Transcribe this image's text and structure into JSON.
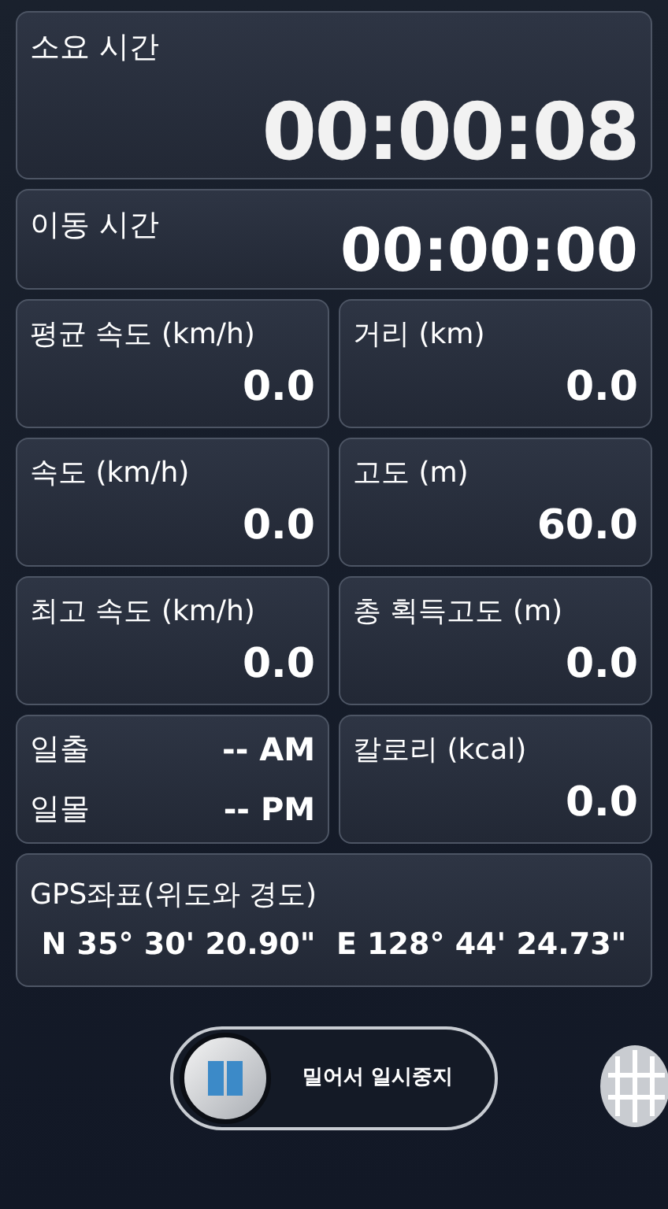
{
  "elapsed": {
    "label": "소요 시간",
    "value": "00:00:08"
  },
  "moving": {
    "label": "이동 시간",
    "value": "00:00:00"
  },
  "stats": [
    {
      "kind": "stat",
      "label": "평균 속도 (km/h)",
      "value": "0.0"
    },
    {
      "kind": "stat",
      "label": "거리 (km)",
      "value": "0.0"
    },
    {
      "kind": "stat",
      "label": "속도 (km/h)",
      "value": "0.0"
    },
    {
      "kind": "stat",
      "label": "고도 (m)",
      "value": "60.0"
    },
    {
      "kind": "stat",
      "label": "최고 속도 (km/h)",
      "value": "0.0"
    },
    {
      "kind": "stat",
      "label": "총 획득고도 (m)",
      "value": "0.0"
    },
    {
      "kind": "sun",
      "rows": [
        {
          "label": "일출",
          "value": "-- AM"
        },
        {
          "label": "일몰",
          "value": "-- PM"
        }
      ]
    },
    {
      "kind": "stat",
      "label": "칼로리 (kcal)",
      "value": "0.0"
    }
  ],
  "gps": {
    "label": "GPS좌표(위도와 경도)",
    "value": "N 35° 30' 20.90\"  E 128° 44' 24.73\""
  },
  "slider": {
    "label": "밀어서 일시중지"
  }
}
